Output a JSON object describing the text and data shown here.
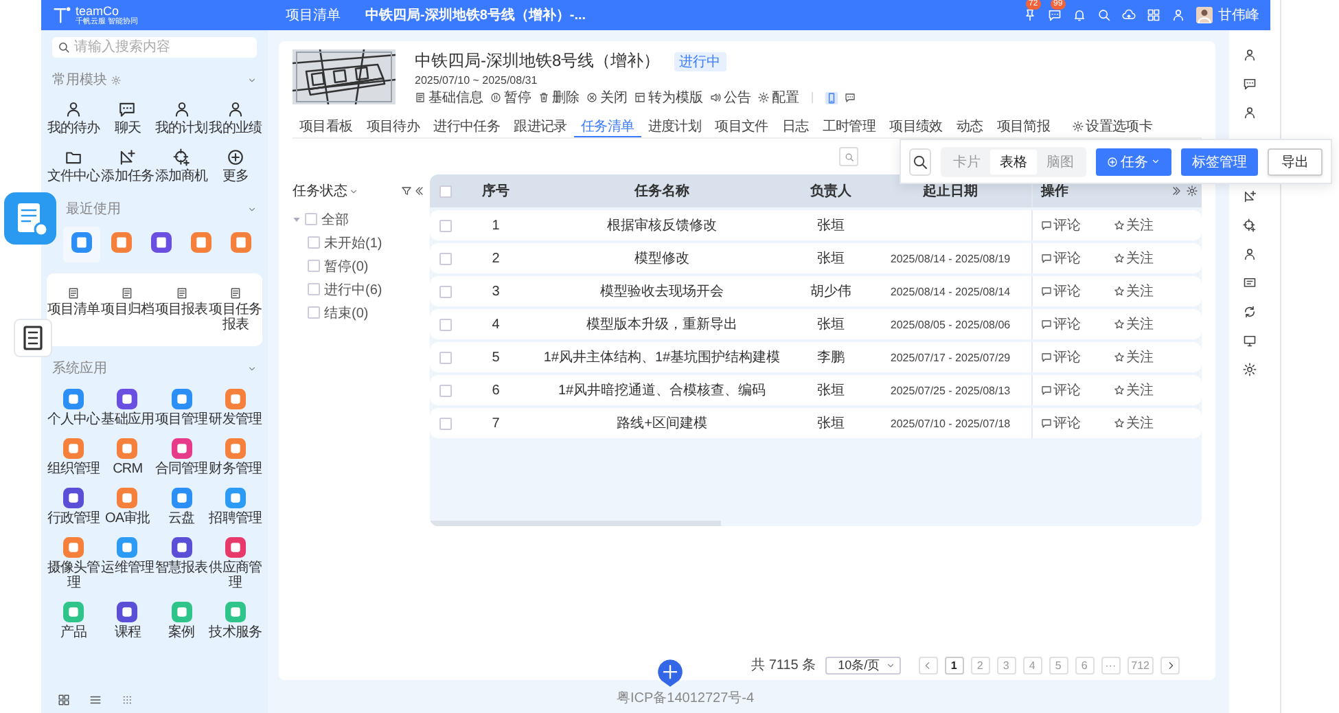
{
  "topbar": {
    "logo": "teamCo",
    "logo_sub": "千帆云服 智能协同",
    "nav": "项目清单",
    "title": "中铁四局-深圳地铁8号线（增补）-...",
    "badges": [
      "72",
      "99"
    ],
    "user": "甘伟峰"
  },
  "sidebar": {
    "search": {
      "placeholder": "请输入搜索内容"
    },
    "common_title": "常用模块",
    "common": [
      {
        "label": "我的待办"
      },
      {
        "label": "聊天"
      },
      {
        "label": "我的计划"
      },
      {
        "label": "我的业绩"
      },
      {
        "label": "文件中心"
      },
      {
        "label": "添加任务"
      },
      {
        "label": "添加商机"
      },
      {
        "label": "更多"
      }
    ],
    "recent_title": "最近使用",
    "recent": [
      {
        "color": "#2b8ff5",
        "selected": true
      },
      {
        "color": "#f5803b",
        "selected": false
      },
      {
        "color": "#6a4fe0",
        "selected": false
      },
      {
        "color": "#f5803b",
        "selected": false
      },
      {
        "color": "#f5803b",
        "selected": false
      }
    ],
    "recent_card": [
      {
        "label": "项目清单"
      },
      {
        "label": "项目归档"
      },
      {
        "label": "项目报表"
      },
      {
        "label": "项目任务报表"
      }
    ],
    "system_title": "系统应用",
    "system": [
      {
        "label": "个人中心",
        "color": "#2b8ff5"
      },
      {
        "label": "基础应用",
        "color": "#6a4fe0"
      },
      {
        "label": "项目管理",
        "color": "#2b8ff5"
      },
      {
        "label": "研发管理",
        "color": "#f5803b"
      },
      {
        "label": "组织管理",
        "color": "#f5803b"
      },
      {
        "label": "CRM",
        "color": "#f5803b"
      },
      {
        "label": "合同管理",
        "color": "#e83a8a"
      },
      {
        "label": "财务管理",
        "color": "#f5803b"
      },
      {
        "label": "行政管理",
        "color": "#5b4fd8"
      },
      {
        "label": "OA审批",
        "color": "#f5803b"
      },
      {
        "label": "云盘",
        "color": "#2b8ff5"
      },
      {
        "label": "招聘管理",
        "color": "#2b9bf5"
      },
      {
        "label": "摄像头管理",
        "color": "#f5803b"
      },
      {
        "label": "运维管理",
        "color": "#2b9bf5"
      },
      {
        "label": "智慧报表",
        "color": "#5b4fd8"
      },
      {
        "label": "供应商管理",
        "color": "#e83a6a"
      },
      {
        "label": "产品",
        "color": "#2fc48a"
      },
      {
        "label": "课程",
        "color": "#5b4fd8"
      },
      {
        "label": "案例",
        "color": "#2fc48a"
      },
      {
        "label": "技术服务",
        "color": "#2fc48a"
      }
    ]
  },
  "project": {
    "title": "中铁四局-深圳地铁8号线（增补）",
    "status": "进行中",
    "dates": "2025/07/10 ~ 2025/08/31",
    "actions": [
      "基础信息",
      "暂停",
      "删除",
      "关闭",
      "转为模版",
      "公告",
      "配置"
    ]
  },
  "tabs": [
    {
      "label": "项目看板",
      "selected": false
    },
    {
      "label": "项目待办",
      "selected": false
    },
    {
      "label": "进行中任务",
      "selected": false
    },
    {
      "label": "跟进记录",
      "selected": false
    },
    {
      "label": "任务清单",
      "selected": true
    },
    {
      "label": "进度计划",
      "selected": false
    },
    {
      "label": "项目文件",
      "selected": false
    },
    {
      "label": "日志",
      "selected": false
    },
    {
      "label": "工时管理",
      "selected": false
    },
    {
      "label": "项目绩效",
      "selected": false
    },
    {
      "label": "动态",
      "selected": false
    },
    {
      "label": "项目简报",
      "selected": false
    }
  ],
  "tab_settings": "设置选项卡",
  "toolbar": {
    "views": [
      {
        "label": "卡片",
        "selected": false
      },
      {
        "label": "表格",
        "selected": true
      },
      {
        "label": "脑图",
        "selected": false
      }
    ],
    "add_task": "任务",
    "tag_button": "标签管理",
    "export_button": "导出"
  },
  "filter": {
    "title": "任务状态",
    "tree": [
      {
        "label": "全部",
        "checked": false,
        "expanded": true,
        "children": [
          {
            "label": "未开始(1)",
            "checked": false
          },
          {
            "label": "暂停(0)",
            "checked": false
          },
          {
            "label": "进行中(6)",
            "checked": false
          },
          {
            "label": "结束(0)",
            "checked": false
          }
        ]
      }
    ]
  },
  "table": {
    "all_checked": false,
    "columns": [
      "序号",
      "任务名称",
      "负责人",
      "起止日期",
      "操作"
    ],
    "rows": [
      {
        "checked": false,
        "no": "1",
        "name": "根据审核反馈修改",
        "owner": "张垣",
        "actions": [
          "评论",
          "关注"
        ]
      },
      {
        "checked": false,
        "no": "2",
        "name": "模型修改",
        "owner": "张垣",
        "dates": "2025/08/14 - 2025/08/19",
        "actions": [
          "评论",
          "关注"
        ]
      },
      {
        "checked": false,
        "no": "3",
        "name": "模型验收去现场开会",
        "owner": "胡少伟",
        "dates": "2025/08/14 - 2025/08/14",
        "actions": [
          "评论",
          "关注"
        ]
      },
      {
        "checked": false,
        "no": "4",
        "name": "模型版本升级，重新导出",
        "owner": "张垣",
        "dates": "2025/08/05 - 2025/08/06",
        "actions": [
          "评论",
          "关注"
        ]
      },
      {
        "checked": false,
        "no": "5",
        "name": "1#风井主体结构、1#基坑围护结构建模",
        "owner": "李鹏",
        "dates": "2025/07/17 - 2025/07/29",
        "actions": [
          "评论",
          "关注"
        ]
      },
      {
        "checked": false,
        "no": "6",
        "name": "1#风井暗挖通道、合模核查、编码",
        "owner": "张垣",
        "dates": "2025/07/25 - 2025/08/13",
        "actions": [
          "评论",
          "关注"
        ]
      },
      {
        "checked": false,
        "no": "7",
        "name": "路线+区间建模",
        "owner": "张垣",
        "dates": "2025/07/10 - 2025/07/18",
        "actions": [
          "评论",
          "关注"
        ]
      }
    ]
  },
  "pagination": {
    "total": "共 7115 条",
    "page_size": "10条/页",
    "pages": [
      {
        "label": "1",
        "selected": true
      },
      {
        "label": "2",
        "selected": false
      },
      {
        "label": "3",
        "selected": false
      },
      {
        "label": "4",
        "selected": false
      },
      {
        "label": "5",
        "selected": false
      },
      {
        "label": "6",
        "selected": false
      },
      {
        "label": "···",
        "selected": false
      },
      {
        "label": "712",
        "selected": false
      }
    ]
  },
  "footer": "粤ICP备14012727号-4"
}
